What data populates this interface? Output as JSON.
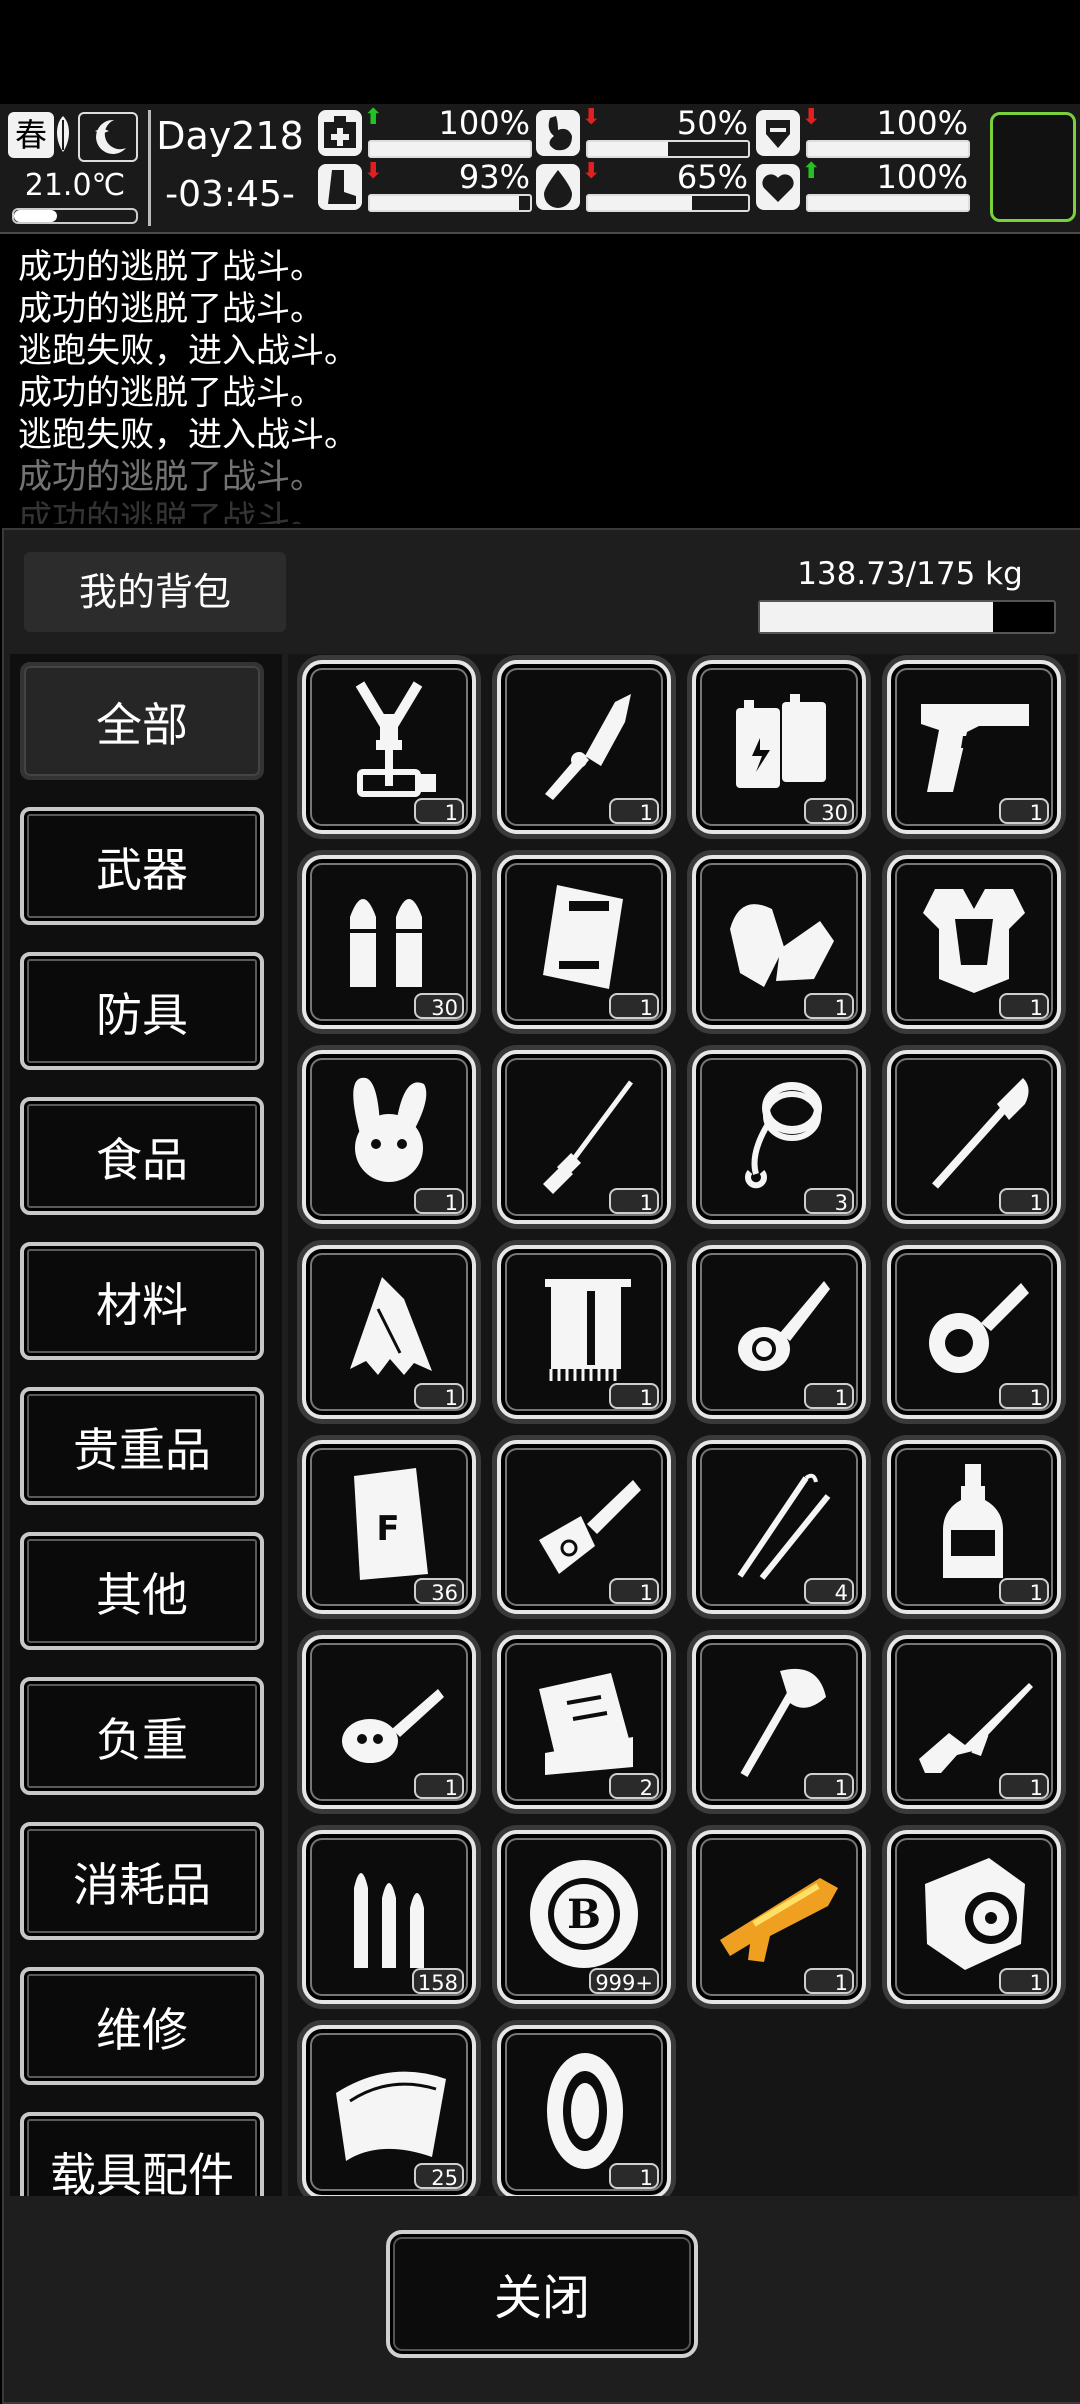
{
  "status": {
    "season": "春",
    "temperature": "21.0℃",
    "temperature_level": 0.35,
    "day": "Day218",
    "time": "-03:45-",
    "stats": [
      {
        "name": "health",
        "icon": "medkit-icon",
        "arrow": "up",
        "value": "100%",
        "level": 1.0
      },
      {
        "name": "hunger",
        "icon": "stomach-icon",
        "arrow": "down",
        "value": "50%",
        "level": 0.5
      },
      {
        "name": "armor",
        "icon": "armor-icon",
        "arrow": "down",
        "value": "100%",
        "level": 1.0
      },
      {
        "name": "stamina",
        "icon": "boot-icon",
        "arrow": "down",
        "value": "93%",
        "level": 0.93
      },
      {
        "name": "thirst",
        "icon": "water-drop-icon",
        "arrow": "down",
        "value": "65%",
        "level": 0.65
      },
      {
        "name": "mood",
        "icon": "heart-icon",
        "arrow": "up",
        "value": "100%",
        "level": 1.0
      }
    ],
    "colors": {
      "arrow_up": "#22c322",
      "arrow_down": "#e02020",
      "slot_border": "#7bd13c"
    }
  },
  "log": [
    "成功的逃脱了战斗。",
    "成功的逃脱了战斗。",
    "逃跑失败，进入战斗。",
    "成功的逃脱了战斗。",
    "逃跑失败，进入战斗。",
    "成功的逃脱了战斗。",
    "成功的逃脱了战斗。"
  ],
  "backpack": {
    "title": "我的背包",
    "weight_text": "138.73/175 kg",
    "weight_fraction": 0.7927
  },
  "categories": [
    "全部",
    "武器",
    "防具",
    "食品",
    "材料",
    "贵重品",
    "其他",
    "负重",
    "消耗品",
    "维修",
    "载具配件"
  ],
  "active_category": "全部",
  "items": [
    {
      "icon": "dna-syringe-kit-icon",
      "count": "1"
    },
    {
      "icon": "jagged-blade-icon",
      "count": "1"
    },
    {
      "icon": "battery-icon",
      "count": "30"
    },
    {
      "icon": "pistol-icon",
      "count": "1"
    },
    {
      "icon": "pistol-bullets-icon",
      "count": "30"
    },
    {
      "icon": "plate-icon",
      "count": "1"
    },
    {
      "icon": "gloves-icon",
      "count": "1"
    },
    {
      "icon": "body-armor-icon",
      "count": "1"
    },
    {
      "icon": "rabbit-hat-icon",
      "count": "1"
    },
    {
      "icon": "screwdriver-icon",
      "count": "1"
    },
    {
      "icon": "rope-icon",
      "count": "3"
    },
    {
      "icon": "shovel-icon",
      "count": "1"
    },
    {
      "icon": "torn-cloth-icon",
      "count": "1"
    },
    {
      "icon": "towel-icon",
      "count": "1"
    },
    {
      "icon": "car-key-icon",
      "count": "1"
    },
    {
      "icon": "gear-key-icon",
      "count": "1"
    },
    {
      "icon": "flour-bag-icon",
      "count": "36"
    },
    {
      "icon": "key-fob-icon",
      "count": "1"
    },
    {
      "icon": "lockpick-icon",
      "count": "4"
    },
    {
      "icon": "bottle-icon",
      "count": "1"
    },
    {
      "icon": "car-remote-key-icon",
      "count": "1"
    },
    {
      "icon": "toolbox-icon",
      "count": "2"
    },
    {
      "icon": "axe-icon",
      "count": "1"
    },
    {
      "icon": "rifle-icon",
      "count": "1"
    },
    {
      "icon": "rifle-bullets-icon",
      "count": "158"
    },
    {
      "icon": "bitcoin-chip-icon",
      "count": "999+"
    },
    {
      "icon": "gold-shotgun-icon",
      "count": "1"
    },
    {
      "icon": "engine-icon",
      "count": "1"
    },
    {
      "icon": "windshield-icon",
      "count": "25"
    },
    {
      "icon": "tire-icon",
      "count": "1"
    }
  ],
  "close_label": "关闭"
}
